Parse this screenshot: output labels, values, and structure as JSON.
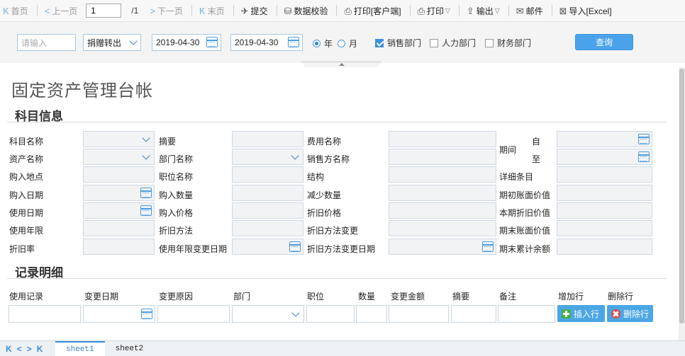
{
  "toolbar": {
    "first": "首页",
    "prev": "上一页",
    "page_value": "1",
    "page_total": "/1",
    "next": "下一页",
    "last": "末页",
    "submit": "提交",
    "validate": "数据校验",
    "print_client": "打印[客户端]",
    "print": "打印",
    "export": "输出",
    "mail": "邮件",
    "import_excel": "导入[Excel]"
  },
  "filter": {
    "input_placeholder": "请输入",
    "type_select": "捐赠转出",
    "date_from": "2019-04-30",
    "date_to": "2019-04-30",
    "radio_year": "年",
    "radio_month": "月",
    "radio_selected": "年",
    "dept_sales": "销售部门",
    "dept_sales_checked": true,
    "dept_hr": "人力部门",
    "dept_hr_checked": false,
    "dept_finance": "财务部门",
    "dept_finance_checked": false,
    "query_button": "查询"
  },
  "report": {
    "title": "固定资产管理台帐",
    "section_subject": "科目信息",
    "section_detail": "记录明细",
    "col1": [
      "科目名称",
      "资产名称",
      "购入地点",
      "购入日期",
      "使用日期",
      "使用年限",
      "折旧率"
    ],
    "col2": [
      "摘要",
      "部门名称",
      "职位名称",
      "购入数量",
      "购入价格",
      "折旧方法",
      "使用年限变更日期"
    ],
    "col3": [
      "费用名称",
      "销售方名称",
      "结构",
      "减少数量",
      "折旧价格",
      "折旧方法变更",
      "折旧方法变更日期"
    ],
    "period": "期间",
    "period_from": "自",
    "period_to": "至",
    "col4": [
      "详细条目",
      "期初账面价值",
      "本期折旧价值",
      "期末账面价值",
      "期末累计余额"
    ],
    "detail_headers": [
      "使用记录",
      "变更日期",
      "变更原因",
      "部门",
      "职位",
      "数量",
      "变更金额",
      "摘要",
      "备注",
      "增加行",
      "删除行"
    ],
    "insert_row": "插入行",
    "delete_row": "删除行"
  },
  "sheets": [
    "sheet1",
    "sheet2"
  ],
  "colors": {
    "accent": "#4aa3ea",
    "add_icon": "#44b04a",
    "delete_icon": "#e24545"
  }
}
